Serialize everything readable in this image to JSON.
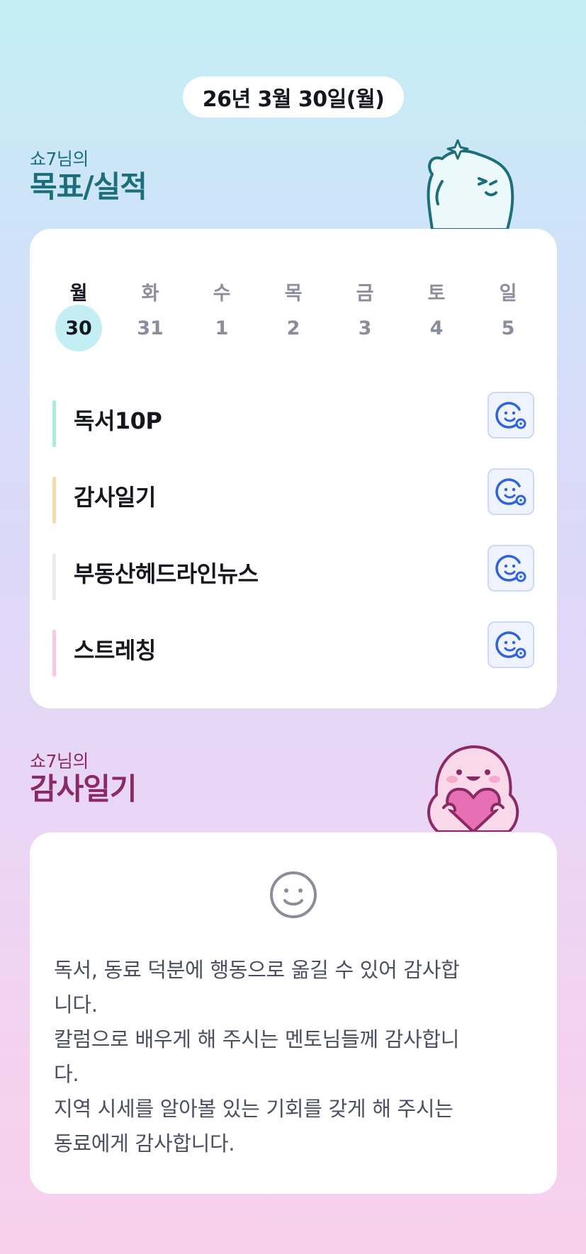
{
  "header": {
    "date": "26년 3월 30일(월)"
  },
  "goals_section": {
    "subtitle": "쇼7님의",
    "title": "목표/실적",
    "week": {
      "days": [
        "월",
        "화",
        "수",
        "목",
        "금",
        "토",
        "일"
      ],
      "dates": [
        "30",
        "31",
        "1",
        "2",
        "3",
        "4",
        "5"
      ],
      "active_index": 0
    },
    "items": [
      {
        "label": "독서10P",
        "color": "#a8ece0",
        "icon": "smile-add-icon"
      },
      {
        "label": "감사일기",
        "color": "#f7dcb0",
        "icon": "smile-add-icon"
      },
      {
        "label": "부동산헤드라인뉴스",
        "color": "#ececef",
        "icon": "smile-add-icon"
      },
      {
        "label": "스트레칭",
        "color": "#f7c9e2",
        "icon": "smile-add-icon"
      }
    ]
  },
  "thanks_section": {
    "subtitle": "쇼7님의",
    "title": "감사일기",
    "icon": "smile-icon",
    "lines": [
      "독서, 동료 덕분에 행동으로 옮길 수 있어 감사합",
      "니다.",
      "칼럼으로 배우게 해 주시는 멘토님들께 감사합니",
      "다.",
      "지역 시세를 알아볼  있는 기회를 갖게 해 주시는",
      "동료에게 감사합니다."
    ]
  },
  "colors": {
    "accent_goal": "#1c6f78",
    "accent_thanks": "#8a2a62",
    "active_date_bg": "#c3eff4",
    "button_icon": "#2f63dd"
  }
}
